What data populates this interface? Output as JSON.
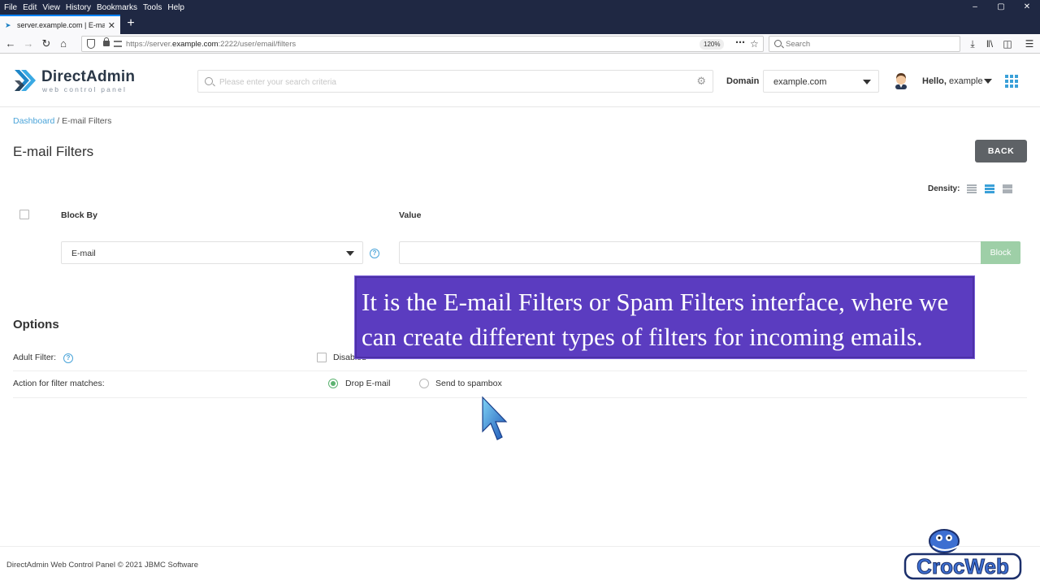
{
  "browser": {
    "menu": [
      "File",
      "Edit",
      "View",
      "History",
      "Bookmarks",
      "Tools",
      "Help"
    ],
    "window_controls": [
      "–",
      "▢",
      "✕"
    ],
    "tab_title": "server.example.com | E-mail Fil",
    "tab_close": "✕",
    "new_tab": "+",
    "url_prefix": "https://server.",
    "url_host": "example.com",
    "url_path": ":2222/user/email/filters",
    "zoom": "120%",
    "search_placeholder": "Search"
  },
  "header": {
    "brand": "DirectAdmin",
    "brand_sub": "web control panel",
    "search_placeholder": "Please enter your search criteria",
    "domain_label": "Domain",
    "domain_value": "example.com",
    "hello": "Hello,",
    "user": "example"
  },
  "breadcrumb": {
    "home": "Dashboard",
    "separator": " / ",
    "current": "E-mail Filters"
  },
  "page": {
    "title": "E-mail Filters",
    "back_label": "BACK",
    "density_label": "Density:"
  },
  "filter_form": {
    "col_block_by": "Block By",
    "col_value": "Value",
    "block_by_value": "E-mail",
    "value_input": "",
    "block_label": "Block",
    "help": "?"
  },
  "options": {
    "title": "Options",
    "adult_filter_label": "Adult Filter:",
    "adult_filter_option": "Disabled",
    "action_label": "Action for filter matches:",
    "action_drop": "Drop E-mail",
    "action_spambox": "Send to spambox",
    "help": "?"
  },
  "caption": {
    "line1": "It is the E-mail Filters or Spam Filters interface, where we",
    "line2": "can create different types of filters for incoming emails."
  },
  "footer": {
    "copyright": "DirectAdmin Web Control Panel © 2021 JBMC Software"
  },
  "watermark": {
    "text": "CrocWeb"
  },
  "colors": {
    "accent_blue": "#4aa4d9",
    "block_button": "#9ecfa7",
    "caption_bg": "#5b3cc0",
    "browser_dark": "#1f2843"
  }
}
